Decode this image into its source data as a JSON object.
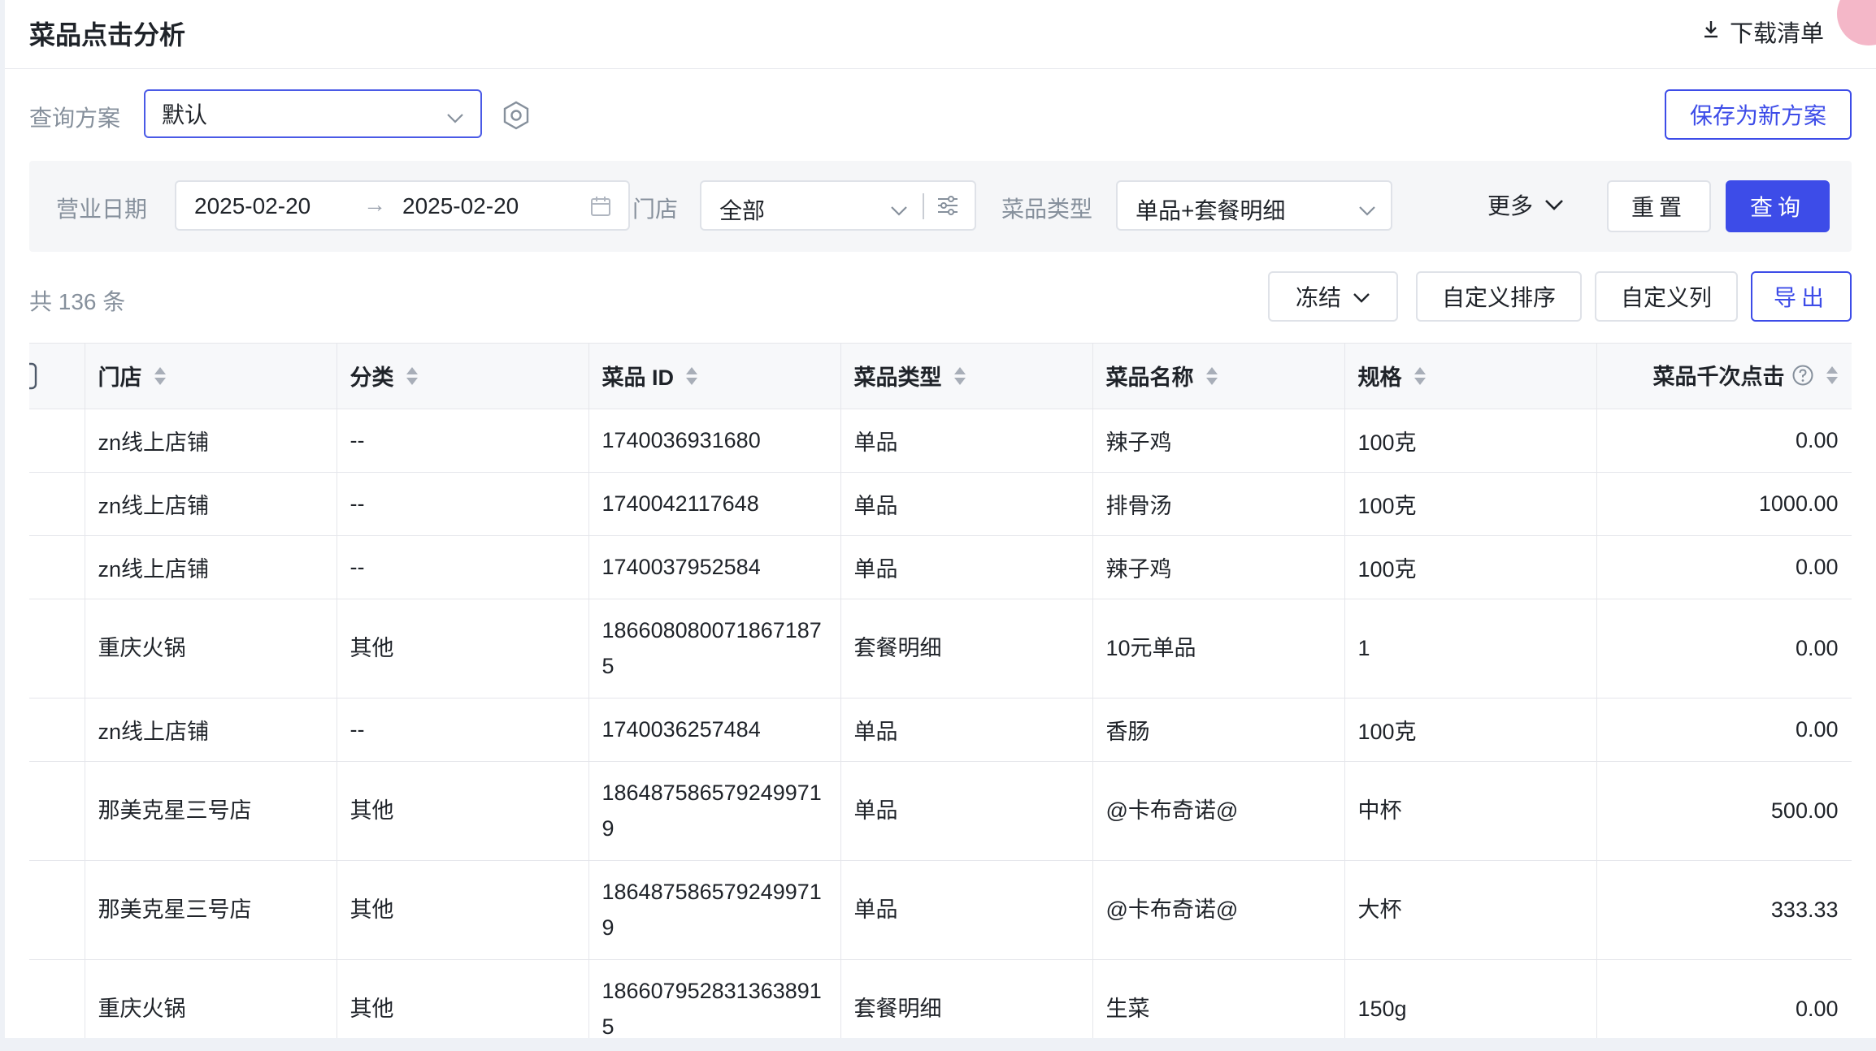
{
  "header": {
    "title": "菜品点击分析",
    "download_label": "下载清单"
  },
  "scheme": {
    "label": "查询方案",
    "selected": "默认",
    "save_label": "保存为新方案"
  },
  "filters": {
    "date_label": "营业日期",
    "date_start": "2025-02-20",
    "date_arrow": "→",
    "date_end": "2025-02-20",
    "store_label": "门店",
    "store_value": "全部",
    "type_label": "菜品类型",
    "type_value": "单品+套餐明细",
    "more_label": "更多",
    "reset_label": "重置",
    "query_label": "查询"
  },
  "toolbar": {
    "count_text": "共 136 条",
    "freeze_label": "冻结",
    "custom_sort_label": "自定义排序",
    "custom_cols_label": "自定义列",
    "export_label": "导出"
  },
  "table": {
    "columns": [
      "门店",
      "分类",
      "菜品 ID",
      "菜品类型",
      "菜品名称",
      "规格",
      "菜品千次点击"
    ],
    "rows": [
      [
        "zn线上店铺",
        "--",
        "1740036931680",
        "单品",
        "辣子鸡",
        "100克",
        "0.00"
      ],
      [
        "zn线上店铺",
        "--",
        "1740042117648",
        "单品",
        "排骨汤",
        "100克",
        "1000.00"
      ],
      [
        "zn线上店铺",
        "--",
        "1740037952584",
        "单品",
        "辣子鸡",
        "100克",
        "0.00"
      ],
      [
        "重庆火锅",
        "其他",
        "1866080800718671875",
        "套餐明细",
        "10元单品",
        "1",
        "0.00"
      ],
      [
        "zn线上店铺",
        "--",
        "1740036257484",
        "单品",
        "香肠",
        "100克",
        "0.00"
      ],
      [
        "那美克星三号店",
        "其他",
        "1864875865792499719",
        "单品",
        "@卡布奇诺@",
        "中杯",
        "500.00"
      ],
      [
        "那美克星三号店",
        "其他",
        "1864875865792499719",
        "单品",
        "@卡布奇诺@",
        "大杯",
        "333.33"
      ],
      [
        "重庆火锅",
        "其他",
        "1866079528313638915",
        "套餐明细",
        "生菜",
        "150g",
        "0.00"
      ]
    ]
  },
  "colors": {
    "primary": "#3d4ce8",
    "muted_text": "#86909c",
    "panel_bg": "#f5f6f8"
  },
  "icons": {
    "download": "download-icon",
    "gear": "gear-icon",
    "calendar": "calendar-icon",
    "filter": "filter-settings-icon",
    "sort": "sort-icon",
    "help": "help-icon",
    "chevron": "chevron-down-icon"
  }
}
